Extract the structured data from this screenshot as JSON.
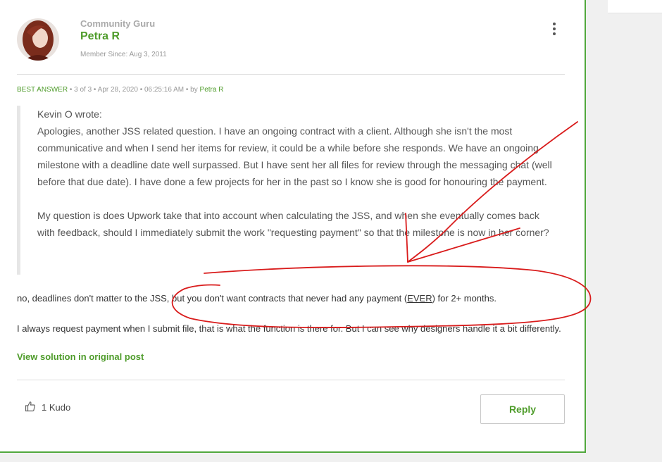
{
  "post": {
    "rank": "Community Guru",
    "author": "Petra R",
    "member_since": "Member Since: Aug 3, 2011",
    "meta": {
      "best_answer": "BEST ANSWER",
      "details": "• 3 of 3 • Apr 28, 2020 • 06:25:16 AM • by ",
      "by_author": "Petra R"
    },
    "quote": {
      "intro": "Kevin O wrote:",
      "para1": "Apologies, another JSS related question. I have an ongoing contract with a client. Although she isn't the most communicative and when I send her items for review, it could be a while before she responds. We have an ongoing milestone with a deadline date well surpassed. But I have sent her all files for review through the messaging chat (well before that due date). I have done a few projects for her in the past so I know she is good for honouring the payment.",
      "para2": "My question is does Upwork take that into account when calculating the JSS, and when she eventually comes back with feedback, should I immediately submit the work \"requesting payment\" so that the milestone is now in her corner?"
    },
    "reply_line1_a": "no, deadlines don't matter to the JSS, but you don't want contracts that never had any payment (",
    "reply_line1_ever": "EVER",
    "reply_line1_b": ") for 2+ months.",
    "reply_line2": "I always request payment when I submit file, that is what the function is there for. But I can see why designers handle it a bit differently.",
    "view_solution": "View solution in original post"
  },
  "footer": {
    "kudo_label": "1 Kudo",
    "reply_label": "Reply"
  },
  "colors": {
    "accent": "#4f9c2b",
    "card_border": "#51a83d",
    "annotation": "#d91c1c"
  }
}
